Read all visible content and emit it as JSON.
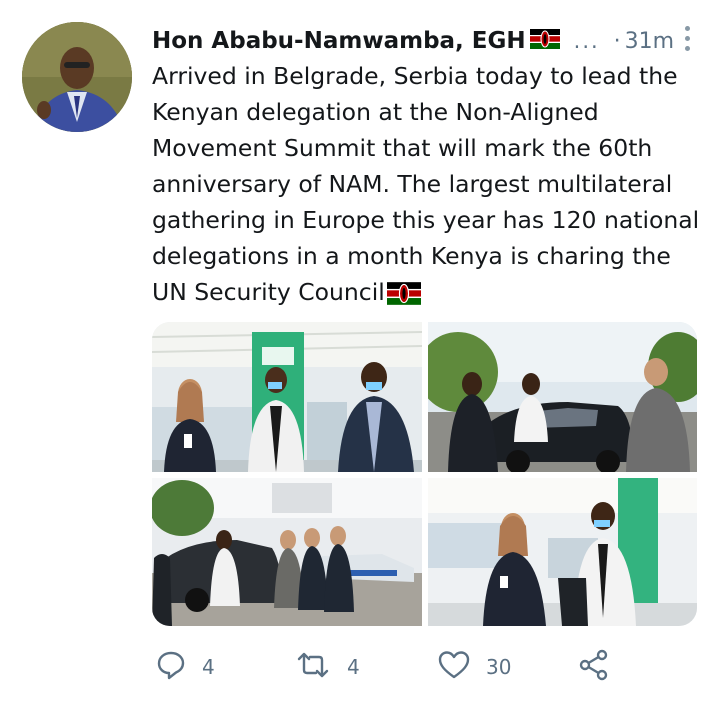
{
  "tweet": {
    "author_name": "Hon Ababu-Namwamba, EGH",
    "ellipsis": "...",
    "separator": "·",
    "time": "31m",
    "text": "Arrived in Belgrade, Serbia today to lead the Kenyan delegation at the Non-Aligned Movement Summit that will mark the 60th anniversary of NAM. The largest multilateral gathering in Europe this year has 120 national delegations in a month Kenya is charing the UN Security Council"
  },
  "actions": {
    "reply_icon": "reply-icon",
    "reply_count": "4",
    "retweet_icon": "retweet-icon",
    "retweet_count": "4",
    "like_icon": "heart-icon",
    "like_count": "30",
    "share_icon": "share-icon"
  },
  "colors": {
    "muted": "#5b7083",
    "kenya_black": "#000000",
    "kenya_red": "#bb0000",
    "kenya_green": "#006600"
  }
}
